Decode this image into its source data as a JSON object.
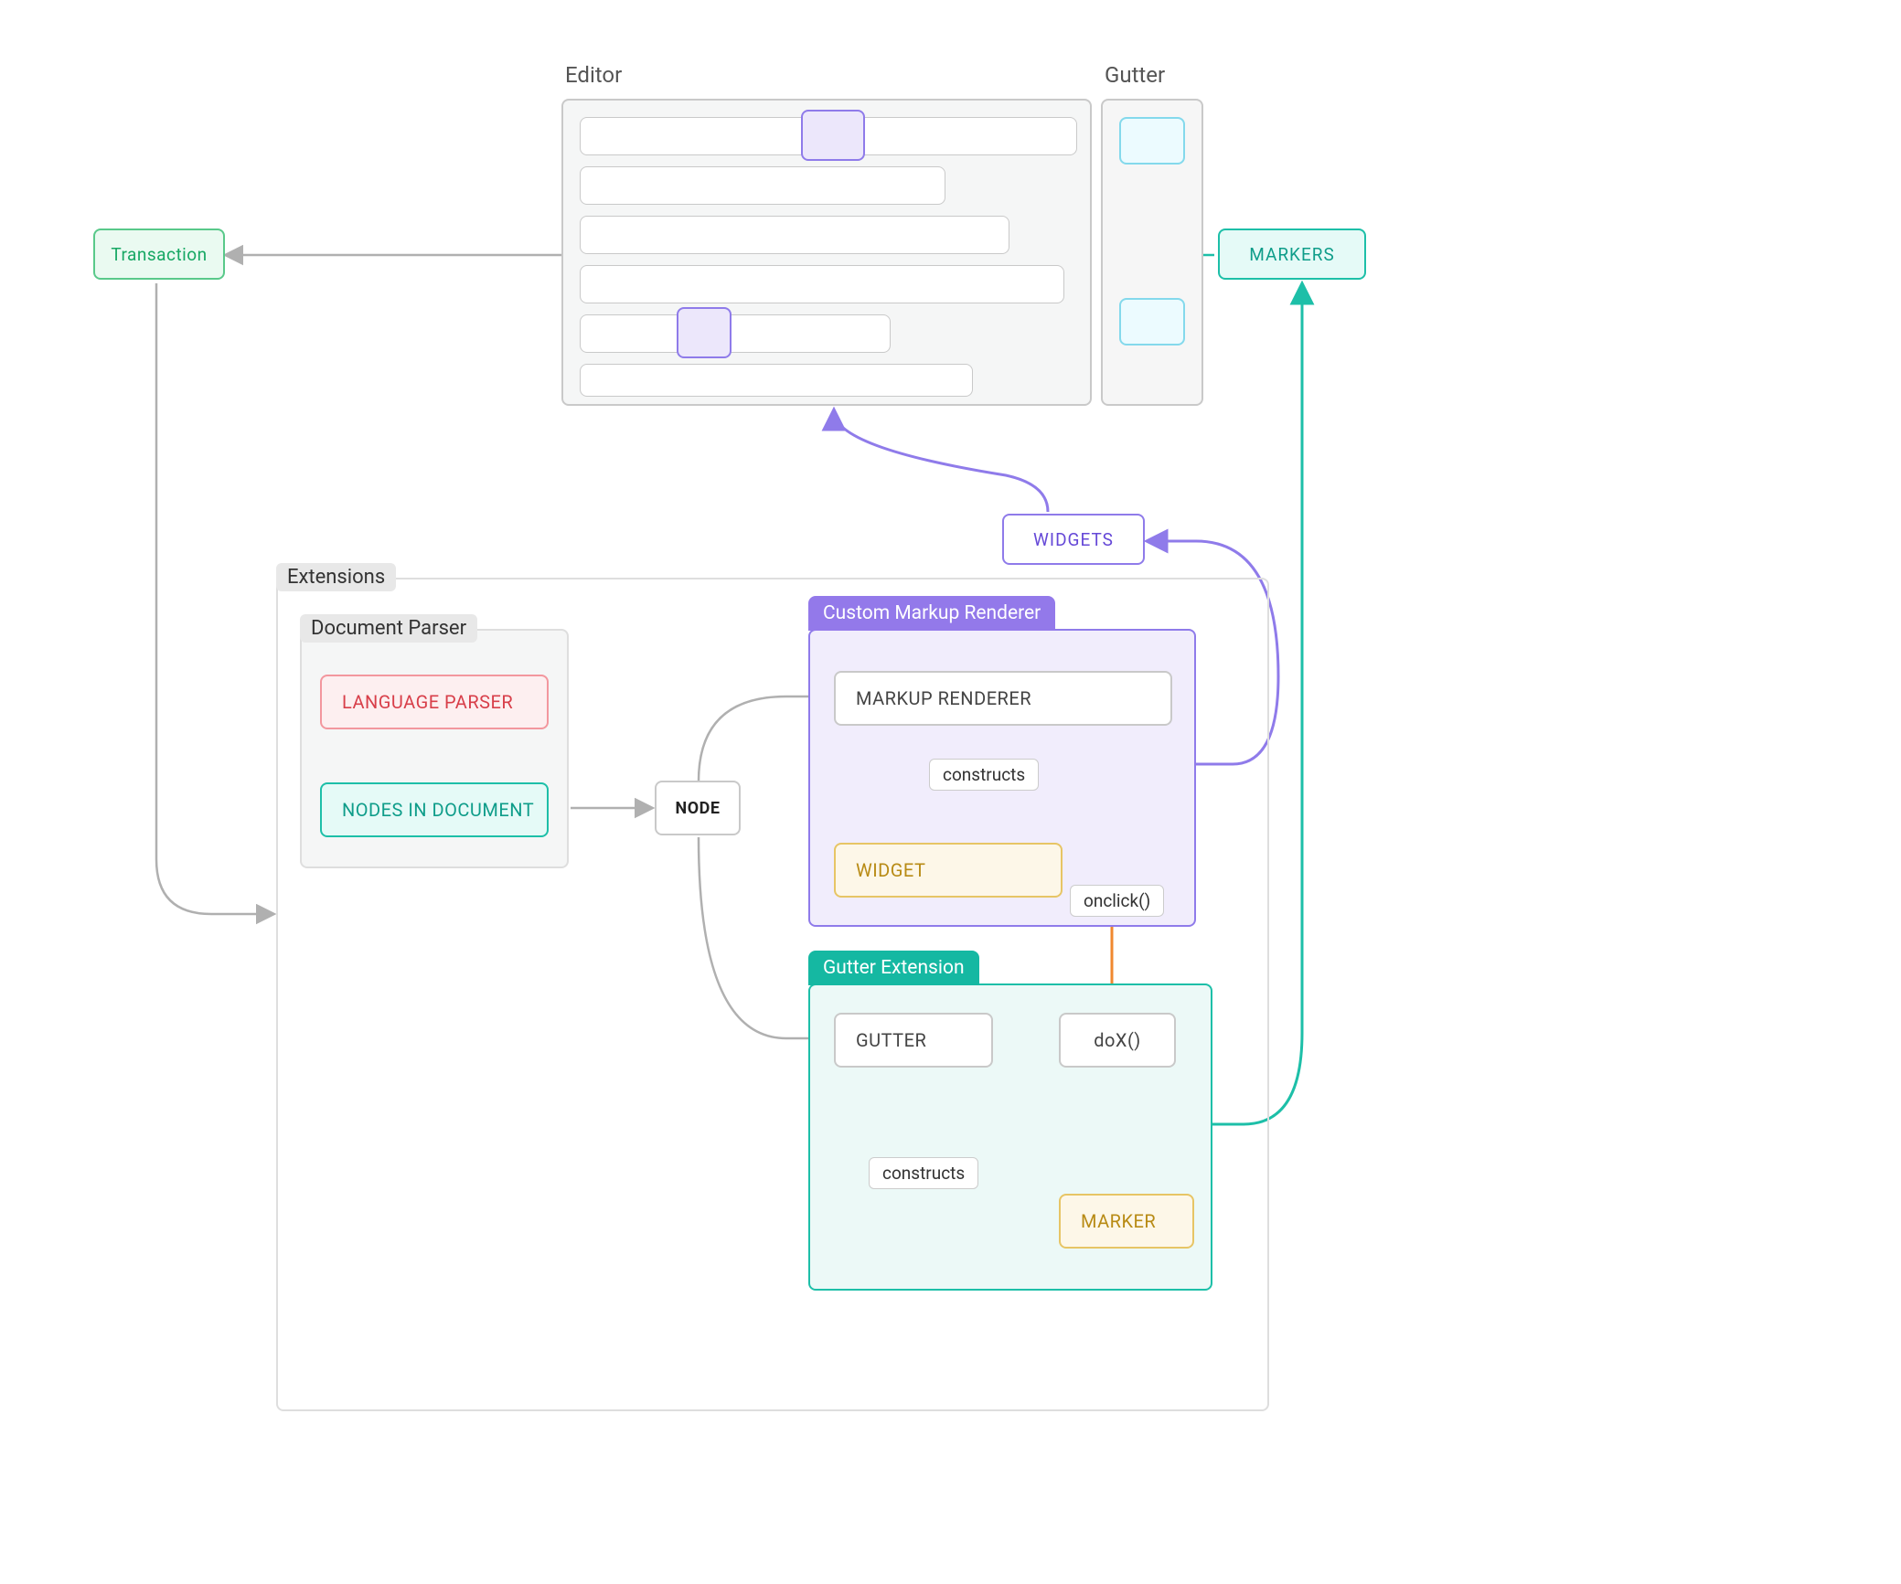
{
  "editor": {
    "title": "Editor"
  },
  "gutter": {
    "title": "Gutter"
  },
  "transaction": {
    "label": "Transaction"
  },
  "markers": {
    "label": "MARKERS"
  },
  "widgets": {
    "label": "WIDGETS"
  },
  "extensions": {
    "title": "Extensions"
  },
  "docparser": {
    "title": "Document Parser",
    "language_parser": "LANGUAGE PARSER",
    "nodes": "NODES IN DOCUMENT"
  },
  "node": {
    "label": "NODE"
  },
  "cmr": {
    "title": "Custom Markup Renderer",
    "renderer": "MARKUP RENDERER",
    "constructs": "constructs",
    "widget": "WIDGET",
    "onclick": "onclick()"
  },
  "gext": {
    "title": "Gutter Extension",
    "gutter": "GUTTER",
    "dox": "doX()",
    "constructs": "constructs",
    "marker": "MARKER"
  },
  "colors": {
    "gray_border": "#c9c9c9",
    "gray_border_light": "#dedede",
    "editor_bg": "#f5f6f6",
    "gutter_bg": "#f6f6f6",
    "green_border": "#59c98a",
    "green_bg": "#eafaf1",
    "green_text": "#17a864",
    "teal_border": "#1dbfa8",
    "teal_bg": "#e5faf7",
    "teal_text": "#0f9d8a",
    "teal_strong_bg": "#15b8a2",
    "cyan_border": "#84d9ec",
    "cyan_bg": "#ecfbff",
    "purple_border": "#8f7bea",
    "purple_bg": "#ece7fb",
    "purple_text": "#6548d7",
    "purple_header_bg": "#9379ea",
    "red_border": "#f3979e",
    "red_bg": "#fdeff0",
    "red_text": "#d83f4a",
    "amber_border": "#e7c565",
    "amber_bg": "#fdf7e8",
    "amber_text": "#b88b15",
    "orange": "#f0882f",
    "conn_gray": "#b0b0b0"
  }
}
